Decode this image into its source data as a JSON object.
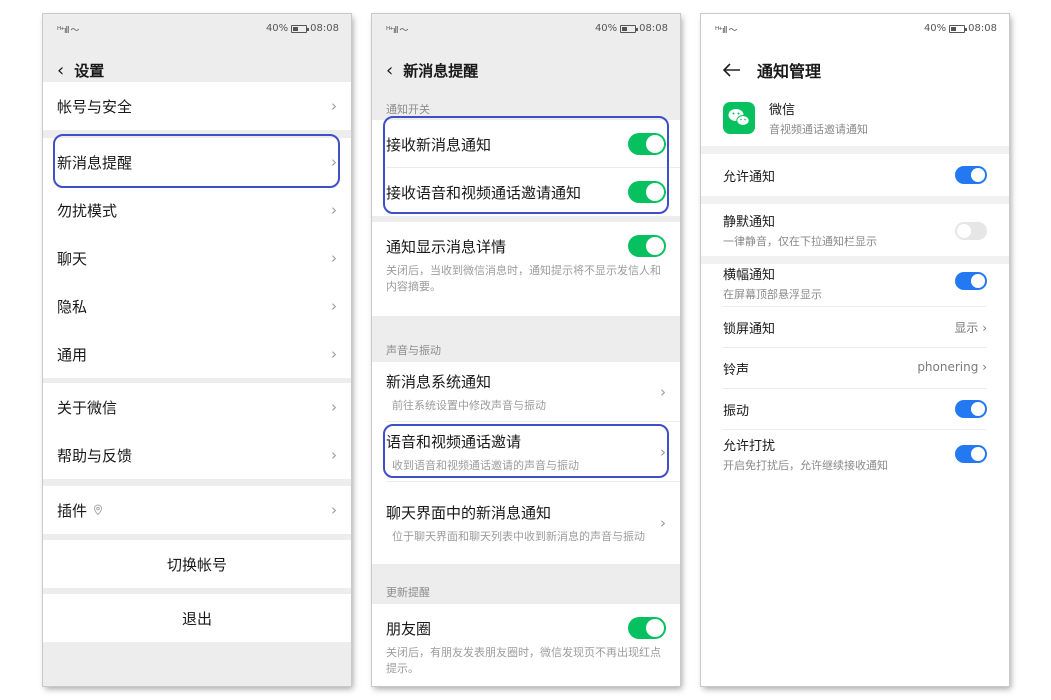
{
  "status": {
    "signal": "ᴴ⁺ıll 〜",
    "battery": "40%",
    "time": "08:08"
  },
  "colors": {
    "wechat_green": "#07c160",
    "android_blue": "#2479f2",
    "highlight": "#3f4fc9"
  },
  "icons": {
    "back": "chevron-left-icon",
    "arrow": "arrow-left-icon",
    "chevron": "chevron-right-icon"
  },
  "panel1": {
    "title": "设置",
    "items": [
      "帐号与安全",
      "新消息提醒",
      "勿扰模式",
      "聊天",
      "隐私",
      "通用",
      "关于微信",
      "帮助与反馈",
      "插件"
    ],
    "switch_account": "切换帐号",
    "logout": "退出"
  },
  "panel2": {
    "title": "新消息提醒",
    "section1": "通知开关",
    "receive": "接收新消息通知",
    "receive_call": "接收语音和视频通话邀请通知",
    "show_detail": "通知显示消息详情",
    "show_detail_sub": "关闭后，当收到微信消息时，通知提示将不显示发信人和内容摘要。",
    "section2": "声音与振动",
    "system_notif": "新消息系统通知",
    "system_notif_sub": "前往系统设置中修改声音与振动",
    "call_invite": "语音和视频通话邀请",
    "call_invite_sub": "收到语音和视频通话邀请的声音与振动",
    "chat_notif": "聊天界面中的新消息通知",
    "chat_notif_sub": "位于聊天界面和聊天列表中收到新消息的声音与振动",
    "section3": "更新提醒",
    "moments": "朋友圈",
    "moments_sub": "关闭后，有朋友发表朋友圈时，微信发现页不再出现红点提示。"
  },
  "panel3": {
    "title": "通知管理",
    "app_name": "微信",
    "app_sub": "音视频通话邀请通知",
    "allow": "允许通知",
    "silent": "静默通知",
    "silent_sub": "一律静音，仅在下拉通知栏显示",
    "banner": "横幅通知",
    "banner_sub": "在屏幕顶部悬浮显示",
    "lock": "锁屏通知",
    "lock_value": "显示",
    "ringtone": "铃声",
    "ringtone_value": "phonering",
    "vibrate": "振动",
    "dnd": "允许打扰",
    "dnd_sub": "开启免打扰后，允许继续接收通知"
  }
}
